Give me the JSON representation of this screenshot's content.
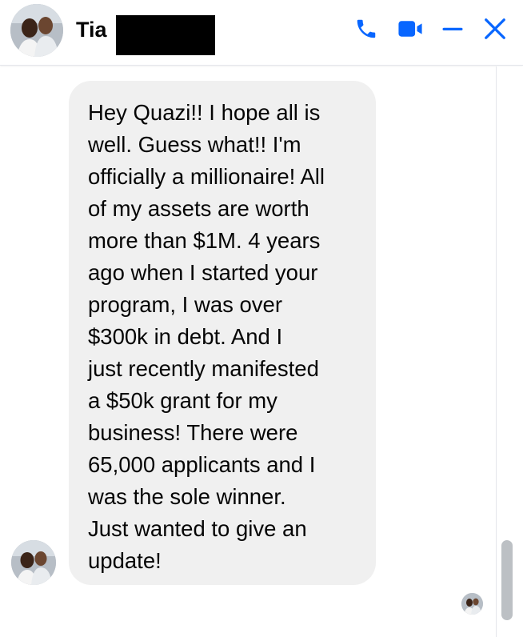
{
  "header": {
    "contact_name": "Tia",
    "icons": {
      "call": "phone-icon",
      "video": "video-camera-icon",
      "minimize": "minus-icon",
      "close": "close-icon"
    },
    "accent_color": "#0866ff"
  },
  "conversation": {
    "messages": [
      {
        "direction": "incoming",
        "text": "Hey Quazi!! I hope all is\nwell. Guess what!! I'm\nofficially a millionaire! All\nof my assets are worth\nmore than $1M. 4 years\nago when I  started your\nprogram, I was over\n$300k in debt. And I\njust recently manifested\na $50k grant for my\nbusiness! There were\n65,000 applicants and I\nwas the sole winner.\nJust wanted to give an\nupdate!"
      }
    ],
    "bubble_color": "#f0f0f0",
    "read_receipt": "seen-avatar"
  },
  "scrollbar": {
    "position": 0.95
  }
}
